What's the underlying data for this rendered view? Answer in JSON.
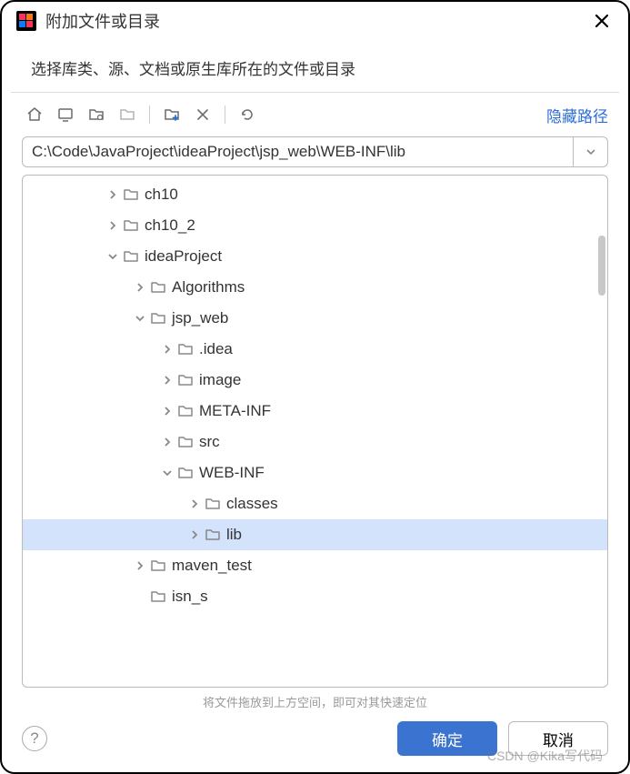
{
  "dialog": {
    "title": "附加文件或目录",
    "subtitle": "选择库类、源、文档或原生库所在的文件或目录"
  },
  "toolbar": {
    "hide_path": "隐藏路径"
  },
  "path": {
    "value": "C:\\Code\\JavaProject\\ideaProject\\jsp_web\\WEB-INF\\lib"
  },
  "tree": [
    {
      "label": "ch10",
      "indent": 3,
      "expanded": false,
      "selected": false
    },
    {
      "label": "ch10_2",
      "indent": 3,
      "expanded": false,
      "selected": false
    },
    {
      "label": "ideaProject",
      "indent": 3,
      "expanded": true,
      "selected": false
    },
    {
      "label": "Algorithms",
      "indent": 4,
      "expanded": false,
      "selected": false
    },
    {
      "label": "jsp_web",
      "indent": 4,
      "expanded": true,
      "selected": false
    },
    {
      "label": ".idea",
      "indent": 5,
      "expanded": false,
      "selected": false
    },
    {
      "label": "image",
      "indent": 5,
      "expanded": false,
      "selected": false
    },
    {
      "label": "META-INF",
      "indent": 5,
      "expanded": false,
      "selected": false
    },
    {
      "label": "src",
      "indent": 5,
      "expanded": false,
      "selected": false
    },
    {
      "label": "WEB-INF",
      "indent": 5,
      "expanded": true,
      "selected": false
    },
    {
      "label": "classes",
      "indent": 6,
      "expanded": false,
      "selected": false
    },
    {
      "label": "lib",
      "indent": 6,
      "expanded": false,
      "selected": true
    },
    {
      "label": "maven_test",
      "indent": 4,
      "expanded": false,
      "selected": false
    },
    {
      "label": "isn_s",
      "indent": 4,
      "expanded": null,
      "selected": false
    }
  ],
  "hint": "将文件拖放到上方空间，即可对其快速定位",
  "footer": {
    "ok": "确定",
    "cancel": "取消"
  },
  "watermark": "CSDN @Kika写代码"
}
